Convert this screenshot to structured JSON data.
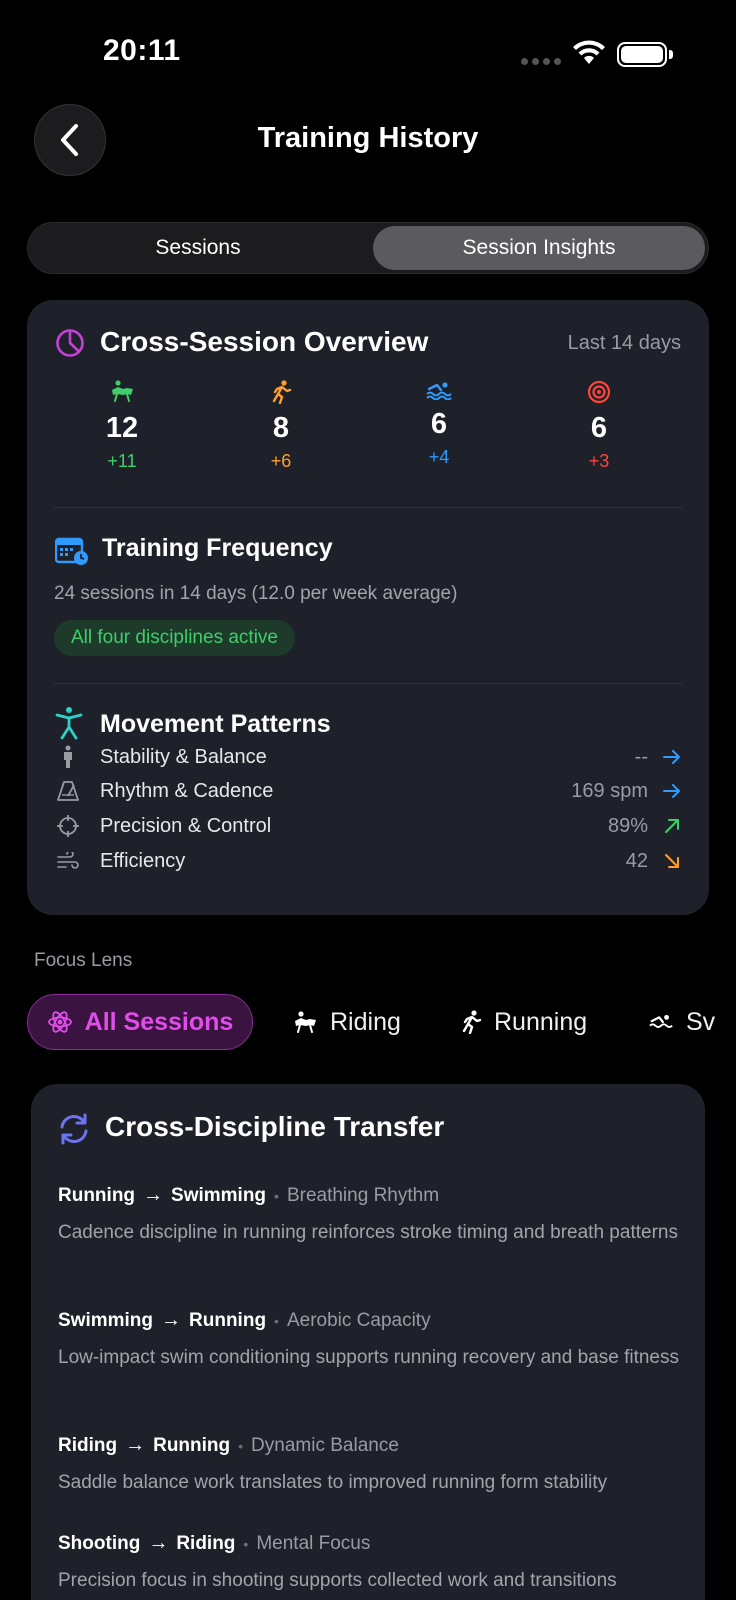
{
  "status": {
    "time": "20:11"
  },
  "header": {
    "title": "Training History"
  },
  "tabs": {
    "left": "Sessions",
    "right": "Session Insights"
  },
  "overview": {
    "title": "Cross-Session Overview",
    "range": "Last 14 days",
    "stats": [
      {
        "icon": "riding-icon",
        "value": "12",
        "delta": "+11",
        "color": "#3ecf6a"
      },
      {
        "icon": "running-icon",
        "value": "8",
        "delta": "+6",
        "color": "#ff9f2e"
      },
      {
        "icon": "swimming-icon",
        "value": "6",
        "delta": "+4",
        "color": "#2f9bff"
      },
      {
        "icon": "target-icon",
        "value": "6",
        "delta": "+3",
        "color": "#ff453a"
      }
    ],
    "frequency": {
      "title": "Training Frequency",
      "summary": "24 sessions in 14 days (12.0 per week average)",
      "badge": "All four disciplines active"
    },
    "movement": {
      "title": "Movement Patterns",
      "rows": [
        {
          "label": "Stability & Balance",
          "value": "--",
          "trend": "right",
          "trend_color": "#2f9bff"
        },
        {
          "label": "Rhythm & Cadence",
          "value": "169 spm",
          "trend": "right",
          "trend_color": "#2f9bff"
        },
        {
          "label": "Precision & Control",
          "value": "89%",
          "trend": "up-right",
          "trend_color": "#3ecf6a"
        },
        {
          "label": "Efficiency",
          "value": "42",
          "trend": "down-right",
          "trend_color": "#ff9f2e"
        }
      ]
    }
  },
  "focus_lens": {
    "label": "Focus Lens",
    "chips": [
      "All Sessions",
      "Riding",
      "Running",
      "Sv"
    ]
  },
  "transfer": {
    "title": "Cross-Discipline Transfer",
    "items": [
      {
        "from": "Running",
        "to": "Swimming",
        "topic": "Breathing Rhythm",
        "desc": "Cadence discipline in running reinforces stroke timing and breath patterns"
      },
      {
        "from": "Swimming",
        "to": "Running",
        "topic": "Aerobic Capacity",
        "desc": "Low-impact swim conditioning supports running recovery and base fitness"
      },
      {
        "from": "Riding",
        "to": "Running",
        "topic": "Dynamic Balance",
        "desc": "Saddle balance work translates to improved running form stability"
      },
      {
        "from": "Shooting",
        "to": "Riding",
        "topic": "Mental Focus",
        "desc": "Precision focus in shooting supports collected work and transitions"
      }
    ]
  }
}
